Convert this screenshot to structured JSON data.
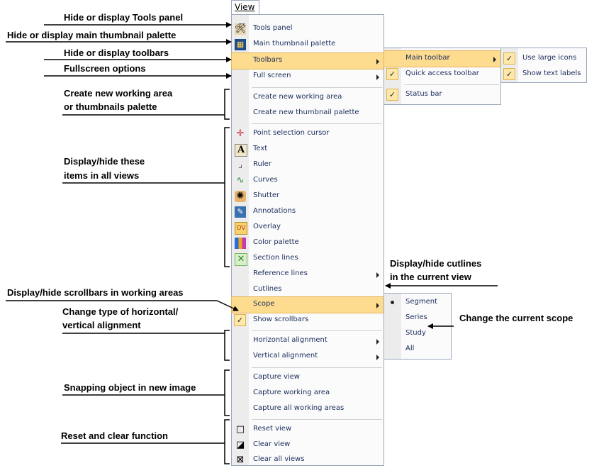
{
  "menu_title": "View",
  "menu_items": [
    {
      "label": "Tools panel",
      "icon": "tools-icon"
    },
    {
      "label": "Main thumbnail palette",
      "icon": "thumbnail-palette-icon"
    },
    {
      "label": "Toolbars",
      "submenu": true
    },
    {
      "label": "Full screen",
      "submenu": true
    },
    {
      "label": "Create new working area"
    },
    {
      "label": "Create new thumbnail palette"
    },
    {
      "label": "Point selection cursor",
      "icon": "point-cursor-icon"
    },
    {
      "label": "Text",
      "icon": "text-icon"
    },
    {
      "label": "Ruler",
      "icon": "ruler-icon"
    },
    {
      "label": "Curves",
      "icon": "curves-icon"
    },
    {
      "label": "Shutter",
      "icon": "shutter-icon"
    },
    {
      "label": "Annotations",
      "icon": "annotations-icon"
    },
    {
      "label": "Overlay",
      "icon": "overlay-icon"
    },
    {
      "label": "Color palette",
      "icon": "color-palette-icon"
    },
    {
      "label": "Section lines",
      "icon": "section-lines-icon"
    },
    {
      "label": "Reference lines",
      "submenu": true
    },
    {
      "label": "Cutlines"
    },
    {
      "label": "Scope",
      "submenu": true
    },
    {
      "label": "Show scrollbars",
      "checked": true
    },
    {
      "label": "Horizontal alignment",
      "submenu": true
    },
    {
      "label": "Vertical alignment",
      "submenu": true
    },
    {
      "label": "Capture view"
    },
    {
      "label": "Capture working area"
    },
    {
      "label": "Capture all working areas"
    },
    {
      "label": "Reset view",
      "icon": "reset-view-icon"
    },
    {
      "label": "Clear view",
      "icon": "clear-view-icon"
    },
    {
      "label": "Clear all views",
      "icon": "clear-all-views-icon"
    }
  ],
  "toolbars_submenu": [
    {
      "label": "Main toolbar",
      "submenu": true
    },
    {
      "label": "Quick access toolbar",
      "checked": true
    },
    {
      "label": "Status bar",
      "checked": true
    }
  ],
  "main_toolbar_submenu": [
    {
      "label": "Use large icons",
      "checked": true
    },
    {
      "label": "Show text labels",
      "checked": true
    }
  ],
  "scope_submenu": [
    {
      "label": "Segment",
      "selected": true
    },
    {
      "label": "Series"
    },
    {
      "label": "Study"
    },
    {
      "label": "All"
    }
  ],
  "annotations": {
    "tools_panel": "Hide or display Tools panel",
    "thumbnail_palette": "Hide or display main thumbnail palette",
    "toolbars": "Hide or display toolbars",
    "fullscreen": "Fullscreen options",
    "create_area_1": "Create new working area",
    "create_area_2": "or thumbnails palette",
    "display_items_1": "Display/hide these",
    "display_items_2": "items in all views",
    "cutlines_1": "Display/hide cutlines",
    "cutlines_2": "in the current view",
    "scrollbars": "Display/hide scrollbars in working areas",
    "alignment_1": "Change type of horizontal/",
    "alignment_2": "vertical  alignment",
    "scope": "Change the current scope",
    "snapping": "Snapping object in new image",
    "reset": "Reset and clear function"
  }
}
